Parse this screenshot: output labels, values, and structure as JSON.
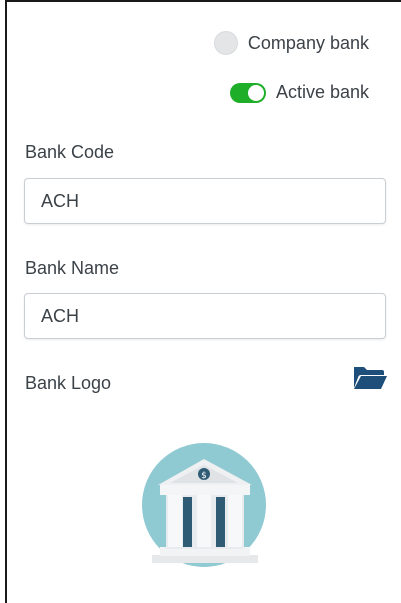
{
  "toggles": {
    "company_bank_label": "Company bank",
    "active_bank_label": "Active bank"
  },
  "fields": {
    "bank_code_label": "Bank Code",
    "bank_code_value": "ACH",
    "bank_name_label": "Bank Name",
    "bank_name_value": "ACH",
    "bank_logo_label": "Bank Logo"
  },
  "icons": {
    "folder": "folder-open-icon",
    "bank_logo": "bank-building-icon"
  },
  "colors": {
    "switch_on": "#1fae28",
    "folder": "#1e4f7a",
    "logo_circle": "#8fc9d2",
    "logo_columns": "#2f5b75"
  }
}
